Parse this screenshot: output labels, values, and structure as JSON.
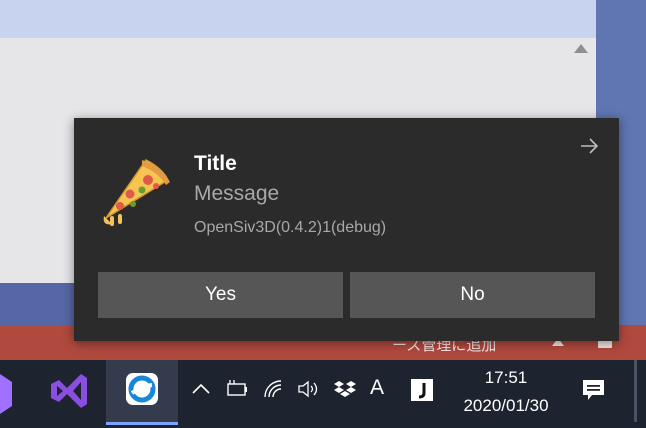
{
  "background": {
    "footer_text": "ース管理に追加"
  },
  "toast": {
    "title": "Title",
    "message": "Message",
    "source": "OpenSiv3D(0.4.2)1(debug)",
    "icon": "pizza-icon",
    "dismiss_icon": "arrow-right-icon",
    "buttons": [
      {
        "label": "Yes"
      },
      {
        "label": "No"
      }
    ]
  },
  "taskbar": {
    "apps": [
      "app-icon",
      "visual-studio-icon",
      "app-active-icon"
    ],
    "tray": {
      "overflow_glyph": "^",
      "ime_label": "A",
      "time": "17:51",
      "date": "2020/01/30"
    }
  }
}
